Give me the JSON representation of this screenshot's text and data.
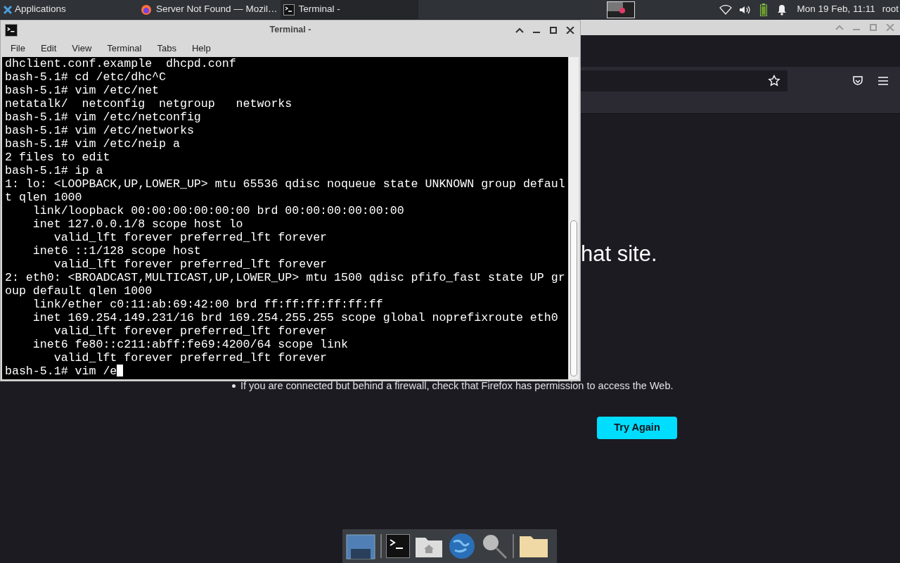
{
  "top_panel": {
    "applications": "Applications",
    "taskbar": [
      {
        "kind": "browser",
        "title": "Server Not Found — Mozil…",
        "selected": false
      },
      {
        "kind": "terminal",
        "title": "Terminal -",
        "selected": true
      }
    ],
    "clock": "Mon 19 Feb, 11:11",
    "user": "root"
  },
  "browser": {
    "heading": "hat site.",
    "bullet": "If you are connected but behind a firewall, check that Firefox has permission to access the Web.",
    "button": "Try Again"
  },
  "terminal": {
    "title": "Terminal -",
    "menu": [
      "File",
      "Edit",
      "View",
      "Terminal",
      "Tabs",
      "Help"
    ],
    "lines": [
      "dhclient.conf.example  dhcpd.conf",
      "bash-5.1# cd /etc/dhc^C",
      "bash-5.1# vim /etc/net",
      "netatalk/  netconfig  netgroup   networks",
      "bash-5.1# vim /etc/netconfig",
      "bash-5.1# vim /etc/networks",
      "bash-5.1# vim /etc/neip a",
      "2 files to edit",
      "bash-5.1# ip a",
      "1: lo: <LOOPBACK,UP,LOWER_UP> mtu 65536 qdisc noqueue state UNKNOWN group defaul",
      "t qlen 1000",
      "    link/loopback 00:00:00:00:00:00 brd 00:00:00:00:00:00",
      "    inet 127.0.0.1/8 scope host lo",
      "       valid_lft forever preferred_lft forever",
      "    inet6 ::1/128 scope host",
      "       valid_lft forever preferred_lft forever",
      "2: eth0: <BROADCAST,MULTICAST,UP,LOWER_UP> mtu 1500 qdisc pfifo_fast state UP gr",
      "oup default qlen 1000",
      "    link/ether c0:11:ab:69:42:00 brd ff:ff:ff:ff:ff:ff",
      "    inet 169.254.149.231/16 brd 169.254.255.255 scope global noprefixroute eth0",
      "       valid_lft forever preferred_lft forever",
      "    inet6 fe80::c211:abff:fe69:4200/64 scope link",
      "       valid_lft forever preferred_lft forever",
      "bash-5.1# vim /e"
    ]
  },
  "dock": [
    {
      "kind": "desktop"
    },
    {
      "kind": "terminal"
    },
    {
      "kind": "home"
    },
    {
      "kind": "globe"
    },
    {
      "kind": "search"
    },
    {
      "kind": "folder"
    }
  ]
}
